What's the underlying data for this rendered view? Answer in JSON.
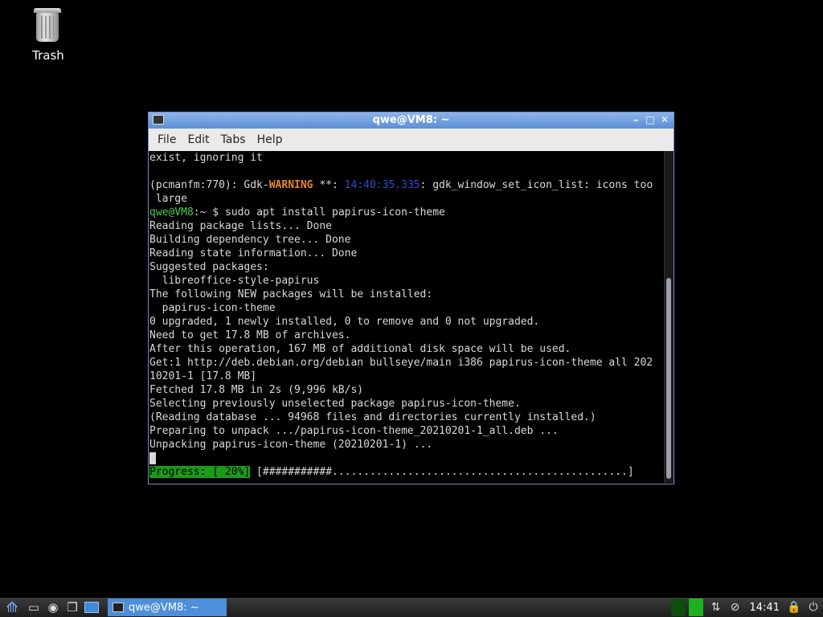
{
  "desktop": {
    "trash_label": "Trash"
  },
  "window": {
    "title": "qwe@VM8: ~",
    "menu": [
      "File",
      "Edit",
      "Tabs",
      "Help"
    ]
  },
  "terminal": {
    "line1": "exist, ignoring it",
    "warn_prefix": "(pcmanfm:770): Gdk-",
    "warn_word": "WARNING",
    "warn_mid": " **: ",
    "warn_time": "14:40:35.335",
    "warn_suffix": ": gdk_window_set_icon_list: icons too",
    "warn_cont": " large",
    "prompt_user": "qwe@VM8",
    "prompt_sep": ":~ $ ",
    "command": "sudo apt install papirus-icon-theme",
    "output": [
      "Reading package lists... Done",
      "Building dependency tree... Done",
      "Reading state information... Done",
      "Suggested packages:",
      "  libreoffice-style-papirus",
      "The following NEW packages will be installed:",
      "  papirus-icon-theme",
      "0 upgraded, 1 newly installed, 0 to remove and 0 not upgraded.",
      "Need to get 17.8 MB of archives.",
      "After this operation, 167 MB of additional disk space will be used.",
      "Get:1 http://deb.debian.org/debian bullseye/main i386 papirus-icon-theme all 202",
      "10201-1 [17.8 MB]",
      "Fetched 17.8 MB in 2s (9,996 kB/s)",
      "Selecting previously unselected package papirus-icon-theme.",
      "(Reading database ... 94968 files and directories currently installed.)",
      "Preparing to unpack .../papirus-icon-theme_20210201-1_all.deb ...",
      "Unpacking papirus-icon-theme (20210201-1) ..."
    ],
    "progress_label": "Progress: [ 20%]",
    "progress_bar": " [###########...............................................]"
  },
  "taskbar": {
    "task_title": "qwe@VM8: ~",
    "clock": "14:41"
  },
  "icons": {
    "start": "lxde-menu-icon",
    "files": "folder-icon",
    "browser": "globe-icon",
    "windows": "window-switch-icon",
    "desktop": "show-desktop-icon",
    "network": "network-arrows-icon",
    "stop": "stop-icon",
    "lock": "lock-icon",
    "power": "power-icon"
  },
  "colors": {
    "titlebar": "#5b8fd6",
    "prompt": "#4ccf4c",
    "warning": "#e8872c",
    "progress_bg": "#1a9c1a"
  }
}
